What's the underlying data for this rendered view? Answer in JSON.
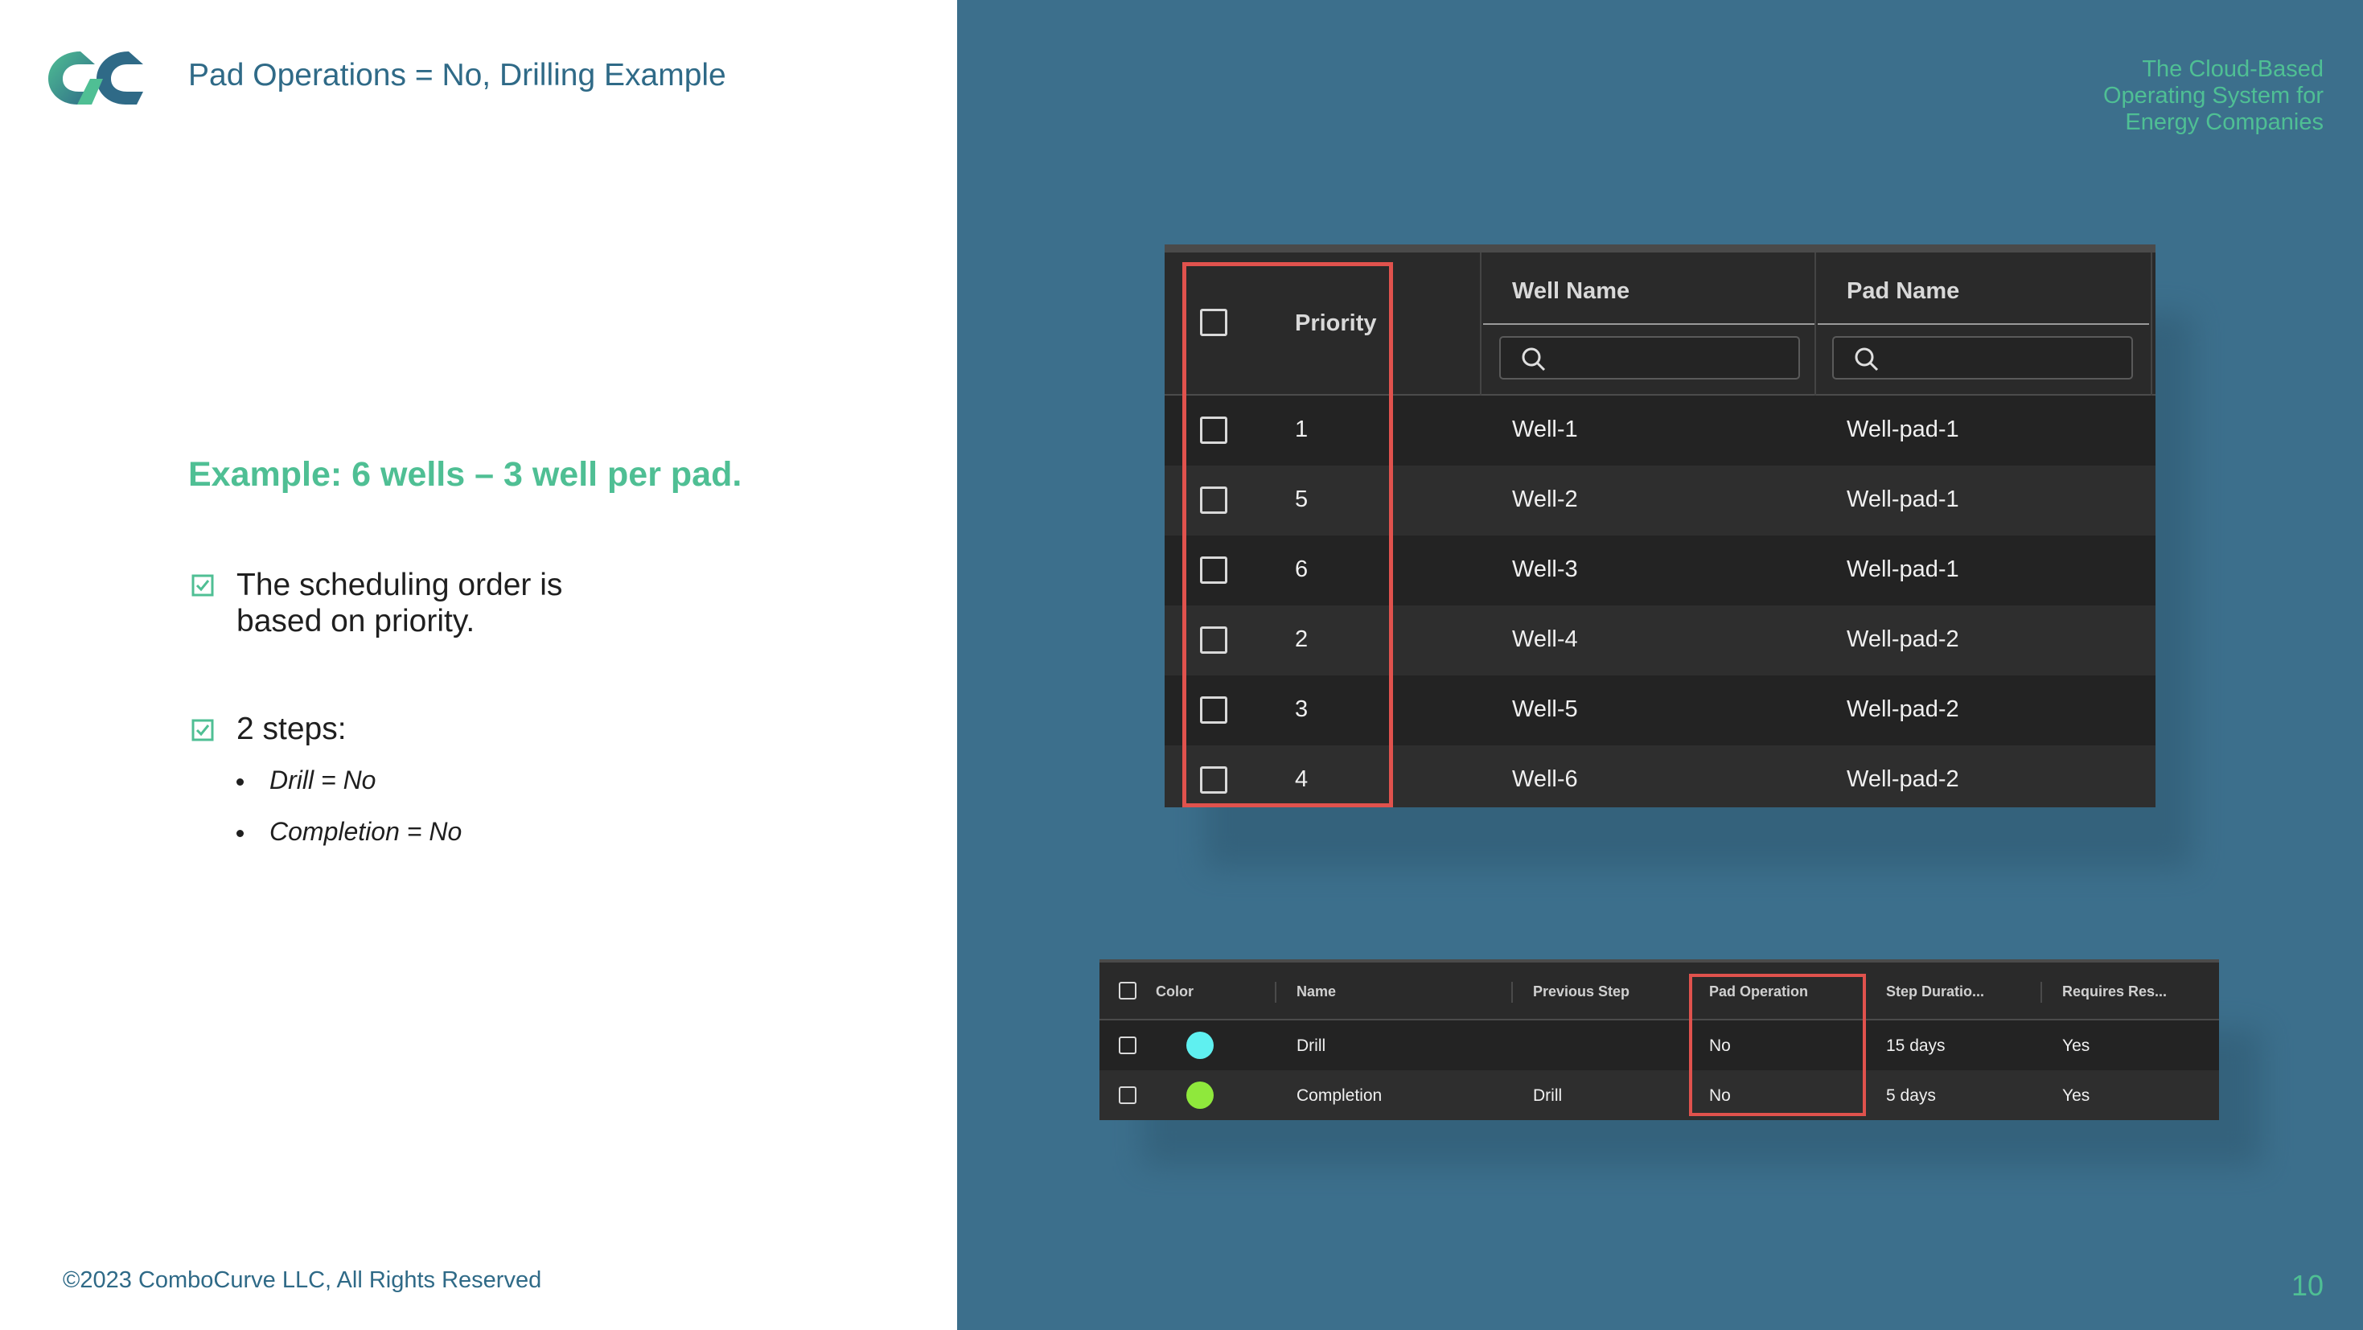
{
  "slide": {
    "title": "Pad Operations = No, Drilling Example",
    "example_heading": "Example: 6 wells – 3 well per pad.",
    "bullets": [
      {
        "line1": "The scheduling order is",
        "line2": "based on priority."
      },
      {
        "line1": "2 steps:"
      }
    ],
    "sub_items": [
      "Drill = No",
      "Completion = No"
    ],
    "copyright": "©2023 ComboCurve LLC, All Rights Reserved",
    "tagline": "The Cloud-Based\nOperating System for\nEnergy Companies",
    "page_number": "10",
    "colors": {
      "brand_green": "#4fbf94",
      "brand_blue": "#2f6a87",
      "panel_bg": "#3c6f8c",
      "highlight_red": "#e0524d"
    }
  },
  "wells_table": {
    "columns": [
      "Priority",
      "Well Name",
      "Pad Name"
    ],
    "search_icon": "search-icon",
    "rows": [
      {
        "priority": "1",
        "well": "Well-1",
        "pad": "Well-pad-1"
      },
      {
        "priority": "5",
        "well": "Well-2",
        "pad": "Well-pad-1"
      },
      {
        "priority": "6",
        "well": "Well-3",
        "pad": "Well-pad-1"
      },
      {
        "priority": "2",
        "well": "Well-4",
        "pad": "Well-pad-2"
      },
      {
        "priority": "3",
        "well": "Well-5",
        "pad": "Well-pad-2"
      },
      {
        "priority": "4",
        "well": "Well-6",
        "pad": "Well-pad-2"
      }
    ]
  },
  "steps_table": {
    "columns": [
      "Color",
      "Name",
      "Previous Step",
      "Pad Operation",
      "Step Duratio...",
      "Requires Res..."
    ],
    "rows": [
      {
        "color": "#5ff0f0",
        "name": "Drill",
        "previous": "",
        "pad_operation": "No",
        "duration": "15 days",
        "requires": "Yes"
      },
      {
        "color": "#8fe83c",
        "name": "Completion",
        "previous": "Drill",
        "pad_operation": "No",
        "duration": "5 days",
        "requires": "Yes"
      }
    ]
  }
}
